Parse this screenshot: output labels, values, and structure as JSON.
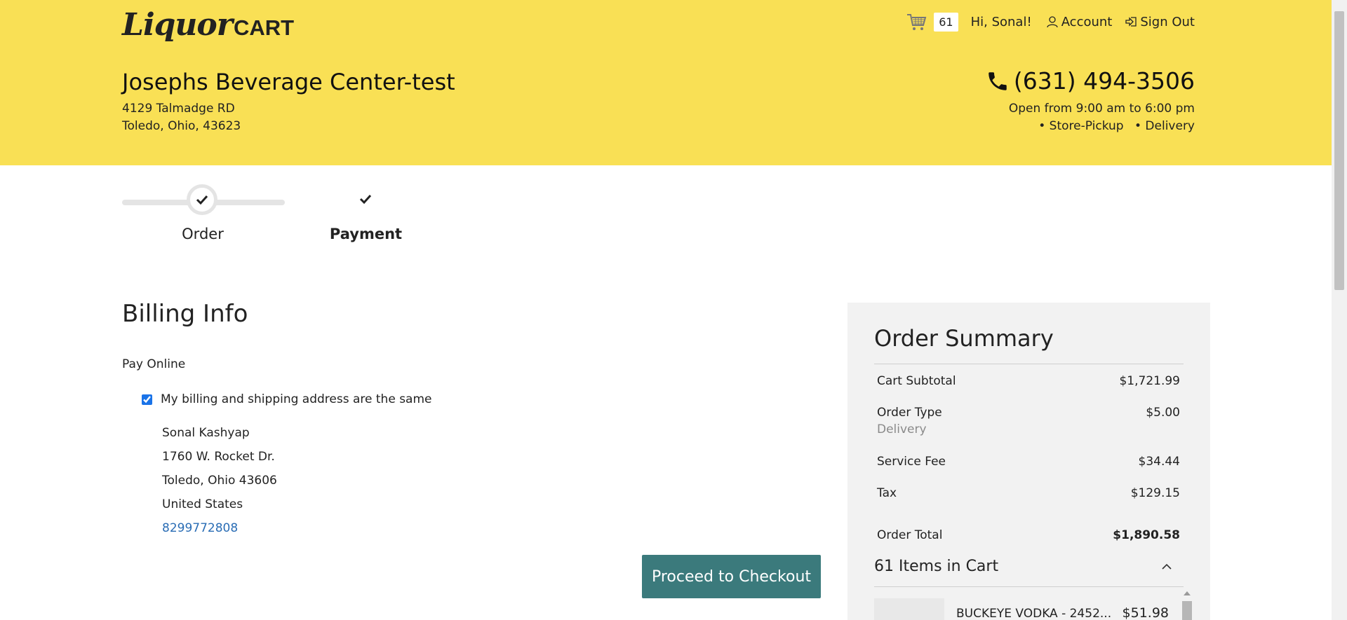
{
  "header": {
    "logo_script": "Liquor",
    "logo_cart": "CART",
    "cart_count": "61",
    "greeting": "Hi, Sonal!",
    "account_label": "Account",
    "signout_label": "Sign Out"
  },
  "store": {
    "name": "Josephs Beverage Center-test",
    "address_line1": "4129 Talmadge RD",
    "address_line2": "Toledo, Ohio, 43623",
    "phone": "(631) 494-3506",
    "hours": "Open from 9:00 am to 6:00 pm",
    "service_pickup": "• Store-Pickup",
    "service_delivery": "• Delivery"
  },
  "steps": {
    "order_label": "Order",
    "payment_label": "Payment"
  },
  "billing": {
    "title": "Billing Info",
    "pay_method": "Pay Online",
    "same_address_label": "My billing and shipping address are the same",
    "name": "Sonal Kashyap",
    "street": "1760 W. Rocket Dr.",
    "city_line": "Toledo, Ohio 43606",
    "country": "United States",
    "phone": "8299772808",
    "checkout_label": "Proceed to Checkout"
  },
  "summary": {
    "title": "Order Summary",
    "subtotal_label": "Cart Subtotal",
    "subtotal_value": "$1,721.99",
    "order_type_label": "Order Type",
    "order_type_value": "$5.00",
    "order_type_sub": "Delivery",
    "service_fee_label": "Service Fee",
    "service_fee_value": "$34.44",
    "tax_label": "Tax",
    "tax_value": "$129.15",
    "total_label": "Order Total",
    "total_value": "$1,890.58",
    "items_label": "61 Items in Cart",
    "items": [
      {
        "name": "BUCKEYE VODKA - 2452...",
        "price": "$51.98"
      }
    ]
  },
  "colors": {
    "header_bg": "#f9e055",
    "checkout_button": "#3b7a7c",
    "summary_bg": "#f2f2f2",
    "link": "#2a6db5"
  }
}
